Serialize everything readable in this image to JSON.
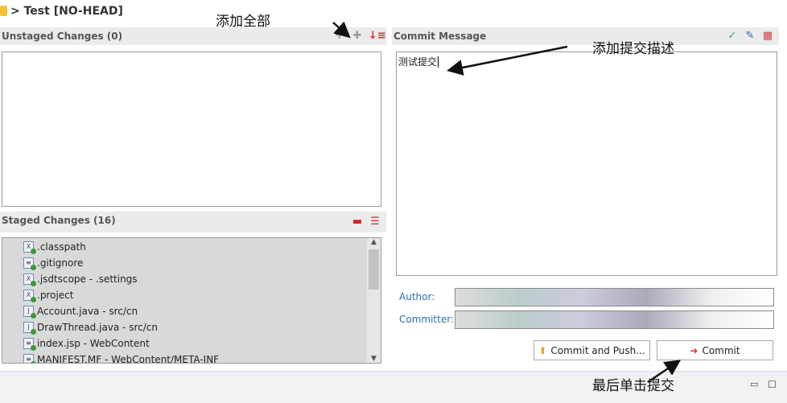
{
  "title": "> Test [NO-HEAD]",
  "unstaged": {
    "header": "Unstaged Changes (0)",
    "icons": [
      "add-icon",
      "add-all-icon",
      "sort-icon"
    ]
  },
  "staged": {
    "header": "Staged Changes (16)",
    "icons": [
      "remove-icon",
      "remove-all-icon"
    ],
    "files": [
      {
        "name": ".classpath",
        "type": "xml"
      },
      {
        "name": ".gitignore",
        "type": "text"
      },
      {
        "name": ".jsdtscope - .settings",
        "type": "xml"
      },
      {
        "name": ".project",
        "type": "xml"
      },
      {
        "name": "Account.java - src/cn",
        "type": "java"
      },
      {
        "name": "DrawThread.java - src/cn",
        "type": "java"
      },
      {
        "name": "index.jsp - WebContent",
        "type": "jsp"
      },
      {
        "name": "MANIFEST.MF - WebContent/META-INF",
        "type": "text"
      }
    ]
  },
  "commit": {
    "header": "Commit Message",
    "icons": [
      "spell-check-icon",
      "edit-icon",
      "signed-off-icon"
    ],
    "message": "测试提交",
    "author_label": "Author:",
    "committer_label": "Committer:",
    "commit_push_label": "Commit and Push...",
    "commit_label": "Commit"
  },
  "annotations": {
    "add_all": "添加全部",
    "add_message": "添加提交描述",
    "click_commit": "最后单击提交"
  },
  "colors": {
    "header_bg": "#ebebeb",
    "label_blue": "#2a6fb8",
    "list_bg": "#d9d9d9"
  }
}
